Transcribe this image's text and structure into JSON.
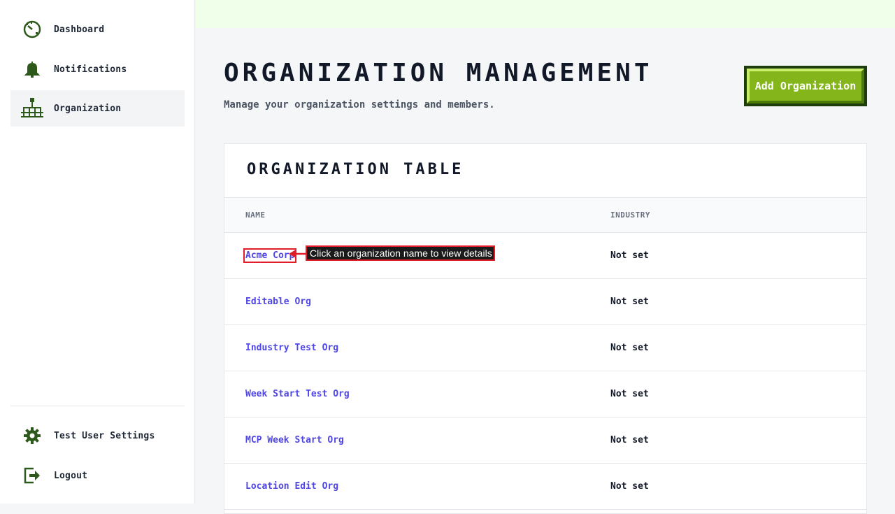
{
  "sidebar": {
    "items": [
      {
        "label": "Dashboard",
        "icon": "dashboard-icon"
      },
      {
        "label": "Notifications",
        "icon": "bell-icon"
      },
      {
        "label": "Organization",
        "icon": "org-chart-icon"
      }
    ],
    "footer": [
      {
        "label": "Test User Settings",
        "icon": "gear-icon"
      },
      {
        "label": "Logout",
        "icon": "logout-icon"
      }
    ]
  },
  "header": {
    "title": "Organization Management",
    "subtitle": "Manage your organization settings and members.",
    "add_button": "Add Organization"
  },
  "table": {
    "title": "Organization Table",
    "columns": [
      "Name",
      "Industry"
    ],
    "rows": [
      {
        "name": "Acme Corp",
        "industry": "Not set"
      },
      {
        "name": "Editable Org",
        "industry": "Not set"
      },
      {
        "name": "Industry Test Org",
        "industry": "Not set"
      },
      {
        "name": "Week Start Test Org",
        "industry": "Not set"
      },
      {
        "name": "MCP Week Start Org",
        "industry": "Not set"
      },
      {
        "name": "Location Edit Org",
        "industry": "Not set"
      }
    ]
  },
  "callout": {
    "text": "Click an organization name to view details"
  },
  "colors": {
    "accent_green": "#84b51a",
    "dark_green": "#1f3d0c",
    "link": "#4f46e5",
    "highlight_red": "#e11d2a",
    "top_band": "#efffe9"
  }
}
